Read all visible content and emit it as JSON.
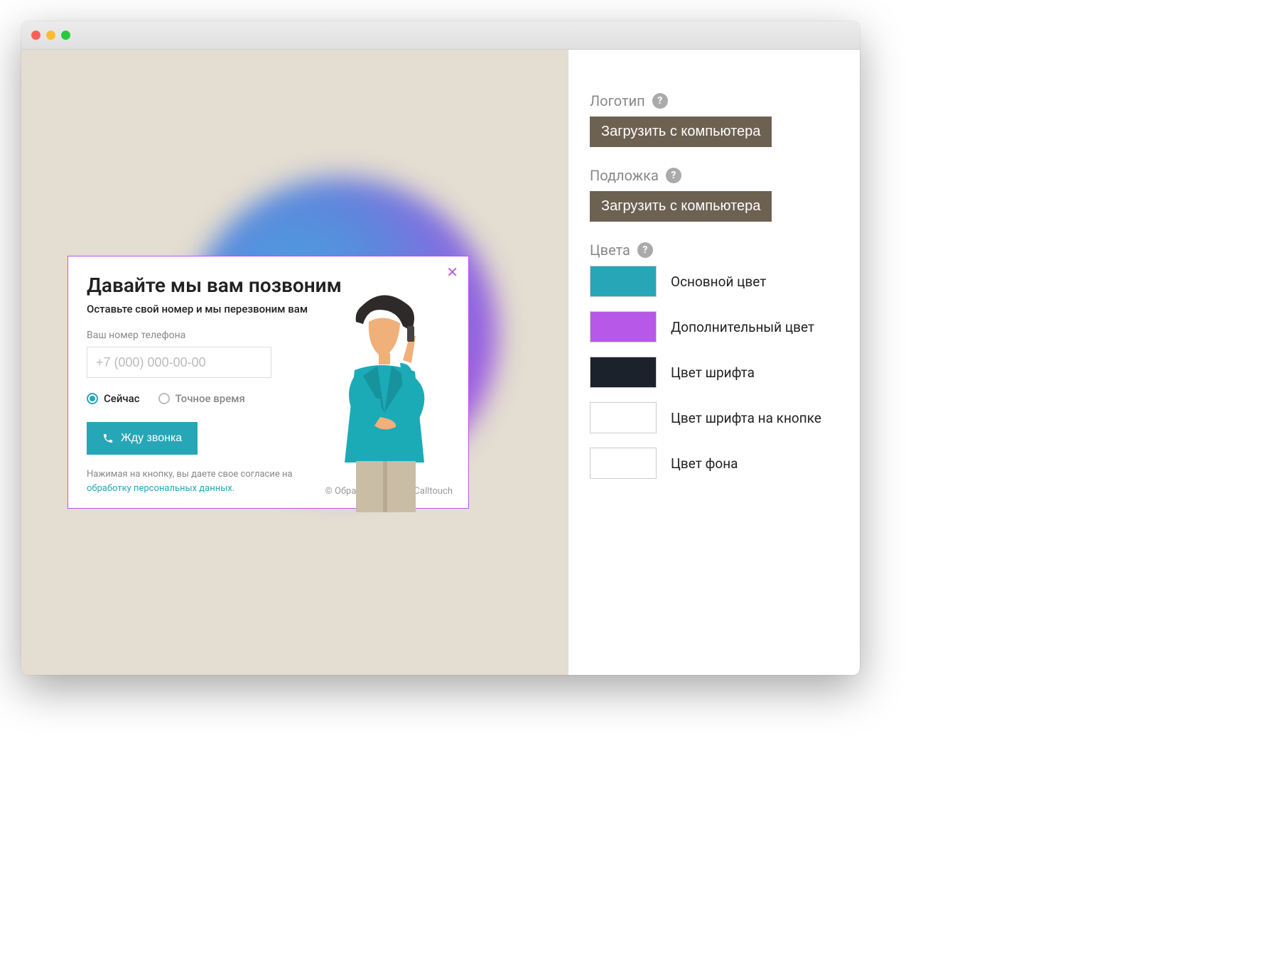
{
  "widget": {
    "title": "Давайте мы вам позвоним",
    "subtitle": "Оставьте свой номер и мы перезвоним вам",
    "phone_label": "Ваш номер телефона",
    "phone_placeholder": "+7 (000) 000-00-00",
    "radio_now": "Сейчас",
    "radio_exact": "Точное время",
    "cta_button": "Жду звонка",
    "consent_prefix": "Нажимая на кнопку, вы даете свое согласие на ",
    "consent_link": "обработку персональных данных.",
    "copyright": "© Обратный звонок Calltouch"
  },
  "panel": {
    "logo_label": "Логотип",
    "logo_upload": "Загрузить с компьютера",
    "bg_label": "Подложка",
    "bg_upload": "Загрузить с компьютера",
    "colors_label": "Цвета",
    "colors": [
      {
        "hex": "#27a6b8",
        "label": "Основной цвет"
      },
      {
        "hex": "#b858e8",
        "label": "Дополнительный цвет"
      },
      {
        "hex": "#1c222b",
        "label": "Цвет шрифта"
      },
      {
        "hex": "#ffffff",
        "label": "Цвет шрифта на кнопке"
      },
      {
        "hex": "#ffffff",
        "label": "Цвет фона"
      }
    ]
  }
}
